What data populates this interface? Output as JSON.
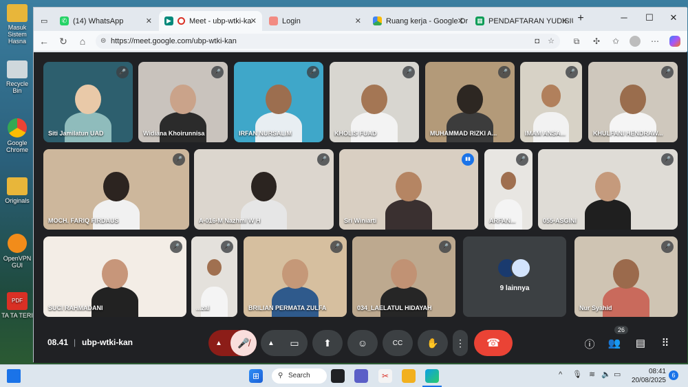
{
  "desktop_icons": [
    {
      "label": "Masuk Sistem Hasna",
      "color": "#e8b63a"
    },
    {
      "label": "Recycle Bin",
      "color": "#cfd8dc"
    },
    {
      "label": "Google Chrome",
      "color": "#ea4335"
    },
    {
      "label": "Originals",
      "color": "#e8b63a"
    },
    {
      "label": "OpenVPN GUI",
      "color": "#f28c1a"
    },
    {
      "label": "TA TA TERI",
      "color": "#d93025"
    }
  ],
  "tabs": [
    {
      "label": "(14) WhatsApp",
      "icon": "whatsapp-icon",
      "color": "#25d366"
    },
    {
      "label": "Meet - ubp-wtki-ka",
      "icon": "meet-icon",
      "color": "#00897b"
    },
    {
      "label": "Login",
      "icon": "login-icon",
      "color": "#f28b82"
    },
    {
      "label": "Ruang kerja - Google Dr",
      "icon": "drive-icon",
      "color": "#fbbc04"
    },
    {
      "label": "PENDAFTARAN YUDISIUM",
      "icon": "sheets-icon",
      "color": "#0f9d58"
    }
  ],
  "address": {
    "url": "https://meet.google.com/ubp-wtki-kan"
  },
  "participants": [
    {
      "name": "Siti Jamilatun UAD",
      "bg": "#2d5f6e",
      "skin": "#e9c9a8",
      "shirt": "#8fbcbc"
    },
    {
      "name": "Widiana Khoirunnisa",
      "bg": "#c9c3bd",
      "skin": "#caa38a",
      "shirt": "#2b2b2b"
    },
    {
      "name": "IRFAN NURSALIM",
      "bg": "#3fa7c9",
      "skin": "#9c6e4f",
      "shirt": "#e8eef2"
    },
    {
      "name": "KHOLIS FUAD",
      "bg": "#d8d6d0",
      "skin": "#a47654",
      "shirt": "#f3f3f3"
    },
    {
      "name": "MUHAMMAD RIZKI A...",
      "bg": "#b39a79",
      "skin": "#2d2722",
      "shirt": "#3c3c3c"
    },
    {
      "name": "IMAM ANSA...",
      "bg": "#d7d2c6",
      "skin": "#b1805c",
      "shirt": "#f2f2f2"
    },
    {
      "name": "KHULFANI HENDRAW...",
      "bg": "#cfc8bd",
      "skin": "#9a6d4d",
      "shirt": "#f5f5f5"
    },
    {
      "name": "MOCH. FARIQ FIRDAUS",
      "bg": "#cdb79c",
      "skin": "#2c2420",
      "shirt": "#f1f1f1"
    },
    {
      "name": "A-016-M Nazhmi W H",
      "bg": "#dcd6ce",
      "skin": "#2b2420",
      "shirt": "#e6e6e6"
    },
    {
      "name": "Sri Winiarti",
      "bg": "#d9cfc2",
      "skin": "#b58563",
      "shirt": "#3a3030"
    },
    {
      "name": "ARFAN...",
      "bg": "#e8e6e2",
      "skin": "#9f6f4f",
      "shirt": "#f4f4f4"
    },
    {
      "name": "055-ASGINI",
      "bg": "#dfdcd6",
      "skin": "#c59a7c",
      "shirt": "#1f1f1f"
    },
    {
      "name": "SUCI RAHMADANI",
      "bg": "#f3ede6",
      "skin": "#c7967a",
      "shirt": "#222222"
    },
    {
      "name": "...zal",
      "bg": "#e4e1dc",
      "skin": "#a07050",
      "shirt": "#f4f4f4"
    },
    {
      "name": "BRILIAN PERMATA ZULFA",
      "bg": "#d6bf9f",
      "skin": "#c59878",
      "shirt": "#2f5a8c"
    },
    {
      "name": "034_LAELATUL HIDAYAH",
      "bg": "#bda98f",
      "skin": "#c19274",
      "shirt": "#262626"
    },
    {
      "name": "9 lainnya",
      "bg": "#3c4043",
      "skin": "#d2e3fc",
      "shirt": "#1a3a6e"
    },
    {
      "name": "Nur Syahid",
      "bg": "#cfc4b3",
      "skin": "#9b6a4c",
      "shirt": "#c96a5c"
    }
  ],
  "meeting": {
    "time": "08.41",
    "code": "ubp-wtki-kan",
    "participant_count": "26"
  },
  "taskbar": {
    "search_label": "Search",
    "clock_time": "08:41",
    "clock_date": "20/08/2025",
    "notification_count": "6"
  },
  "colors": {
    "meet_bg": "#202124",
    "end_call": "#ea4335",
    "mic_off_bg": "#f9dedc"
  }
}
